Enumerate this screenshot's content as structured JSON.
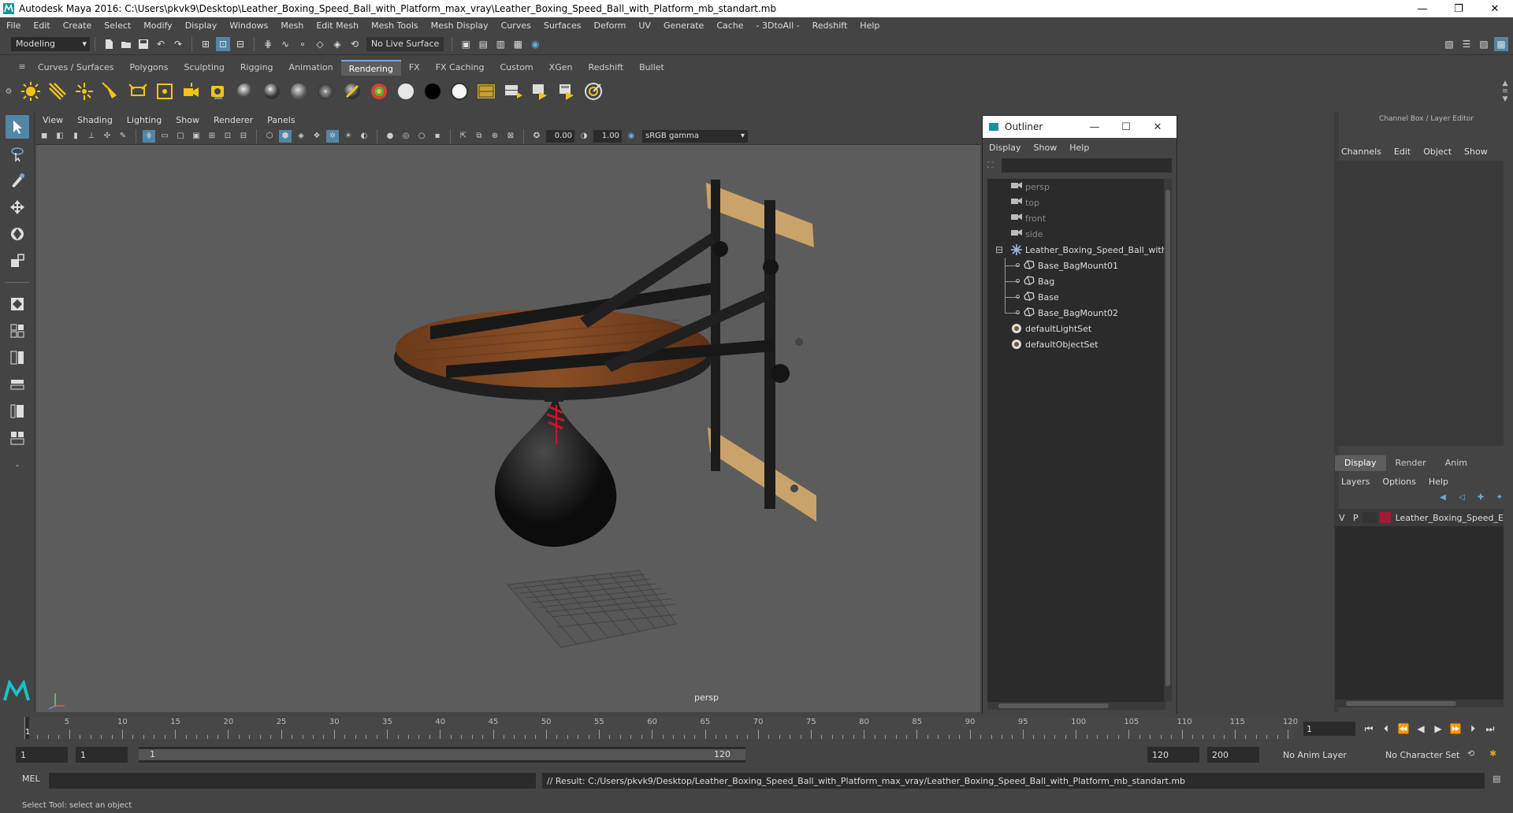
{
  "title_bar": {
    "title": "Autodesk Maya 2016: C:\\Users\\pkvk9\\Desktop\\Leather_Boxing_Speed_Ball_with_Platform_max_vray\\Leather_Boxing_Speed_Ball_with_Platform_mb_standart.mb",
    "minimize": "—",
    "maximize": "❐",
    "close": "✕"
  },
  "menu_bar": [
    "File",
    "Edit",
    "Create",
    "Select",
    "Modify",
    "Display",
    "Windows",
    "Mesh",
    "Edit Mesh",
    "Mesh Tools",
    "Mesh Display",
    "Curves",
    "Surfaces",
    "Deform",
    "UV",
    "Generate",
    "Cache",
    "- 3DtoAll -",
    "Redshift",
    "Help"
  ],
  "status_line": {
    "mode": "Modeling",
    "live_surface": "No Live Surface"
  },
  "shelf_tabs": [
    "Curves / Surfaces",
    "Polygons",
    "Sculpting",
    "Rigging",
    "Animation",
    "Rendering",
    "FX",
    "FX Caching",
    "Custom",
    "XGen",
    "Redshift",
    "Bullet"
  ],
  "active_shelf_tab": "Rendering",
  "viewport": {
    "menu": [
      "View",
      "Shading",
      "Lighting",
      "Show",
      "Renderer",
      "Panels"
    ],
    "exposure": "0.00",
    "gamma": "1.00",
    "color_space": "sRGB gamma",
    "camera_label": "persp"
  },
  "outliner": {
    "title": "Outliner",
    "menu": [
      "Display",
      "Show",
      "Help"
    ],
    "items": [
      {
        "label": "persp",
        "depth": 0,
        "icon": "camera-icon",
        "dim": true
      },
      {
        "label": "top",
        "depth": 0,
        "icon": "camera-icon",
        "dim": true
      },
      {
        "label": "front",
        "depth": 0,
        "icon": "camera-icon",
        "dim": true
      },
      {
        "label": "side",
        "depth": 0,
        "icon": "camera-icon",
        "dim": true
      },
      {
        "label": "Leather_Boxing_Speed_Ball_with_",
        "depth": 0,
        "icon": "group-icon",
        "dim": false,
        "expanded": true
      },
      {
        "label": "Base_BagMount01",
        "depth": 1,
        "icon": "mesh-icon",
        "dim": false
      },
      {
        "label": "Bag",
        "depth": 1,
        "icon": "mesh-icon",
        "dim": false
      },
      {
        "label": "Base",
        "depth": 1,
        "icon": "mesh-icon",
        "dim": false
      },
      {
        "label": "Base_BagMount02",
        "depth": 1,
        "icon": "mesh-icon",
        "dim": false
      },
      {
        "label": "defaultLightSet",
        "depth": 0,
        "icon": "set-icon",
        "dim": false
      },
      {
        "label": "defaultObjectSet",
        "depth": 0,
        "icon": "set-icon",
        "dim": false
      }
    ]
  },
  "channel_box": {
    "title": "Channel Box / Layer Editor",
    "menu": [
      "Channels",
      "Edit",
      "Object",
      "Show"
    ]
  },
  "layer_editor": {
    "tabs": [
      "Display",
      "Render",
      "Anim"
    ],
    "active_tab": "Display",
    "menu": [
      "Layers",
      "Options",
      "Help"
    ],
    "layers": [
      {
        "v": "V",
        "p": "P",
        "name": "Leather_Boxing_Speed_E",
        "color": "#a01c32"
      }
    ]
  },
  "timeline": {
    "ticks": [
      "5",
      "10",
      "15",
      "20",
      "25",
      "30",
      "35",
      "40",
      "45",
      "50",
      "55",
      "60",
      "65",
      "70",
      "75",
      "80",
      "85",
      "90",
      "95",
      "100",
      "105",
      "110",
      "115",
      "120"
    ],
    "current_marker": "1",
    "current_frame": "1"
  },
  "range_slider": {
    "start_time": "1",
    "playback_start": "1",
    "range_start": "1",
    "range_end": "120",
    "playback_end": "120",
    "end_time": "200",
    "anim_layer": "No Anim Layer",
    "character_set": "No Character Set"
  },
  "command_line": {
    "language": "MEL",
    "result": "// Result: C:/Users/pkvk9/Desktop/Leather_Boxing_Speed_Ball_with_Platform_max_vray/Leather_Boxing_Speed_Ball_with_Platform_mb_standart.mb"
  },
  "help_line": "Select Tool: select an object",
  "colors": {
    "accent": "#5285a6",
    "layer_color": "#a01c32"
  }
}
